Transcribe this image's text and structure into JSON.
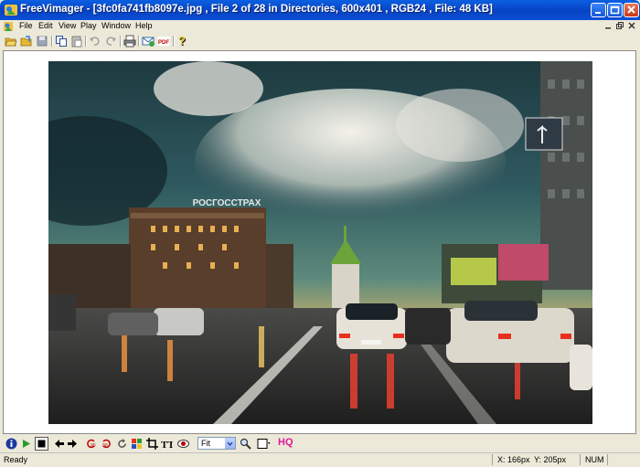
{
  "window": {
    "title": "FreeVimager - [3fc0fa741fb8097e.jpg , File 2 of 28 in Directories, 600x401 , RGB24 , File: 48 KB]"
  },
  "menu": {
    "items": [
      "File",
      "Edit",
      "View",
      "Play",
      "Window",
      "Help"
    ]
  },
  "toolbar": {
    "icons": [
      "open-folder-icon",
      "open-file-icon",
      "save-icon",
      "copy-icon",
      "paste-icon",
      "undo-icon",
      "redo-icon",
      "print-icon",
      "email-icon",
      "pdf-icon",
      "help-icon"
    ]
  },
  "photo": {
    "sign_text": "РОСГОССТРАХ"
  },
  "bottom_toolbar": {
    "zoom_value": "Fit",
    "hq_label": "HQ"
  },
  "status": {
    "ready": "Ready",
    "x_coord": "X: 166px",
    "y_coord": "Y: 205px",
    "num": "NUM"
  },
  "colors": {
    "title_bar": "#0a50d6",
    "chrome": "#ece9d8",
    "hq": "#e0189b"
  }
}
